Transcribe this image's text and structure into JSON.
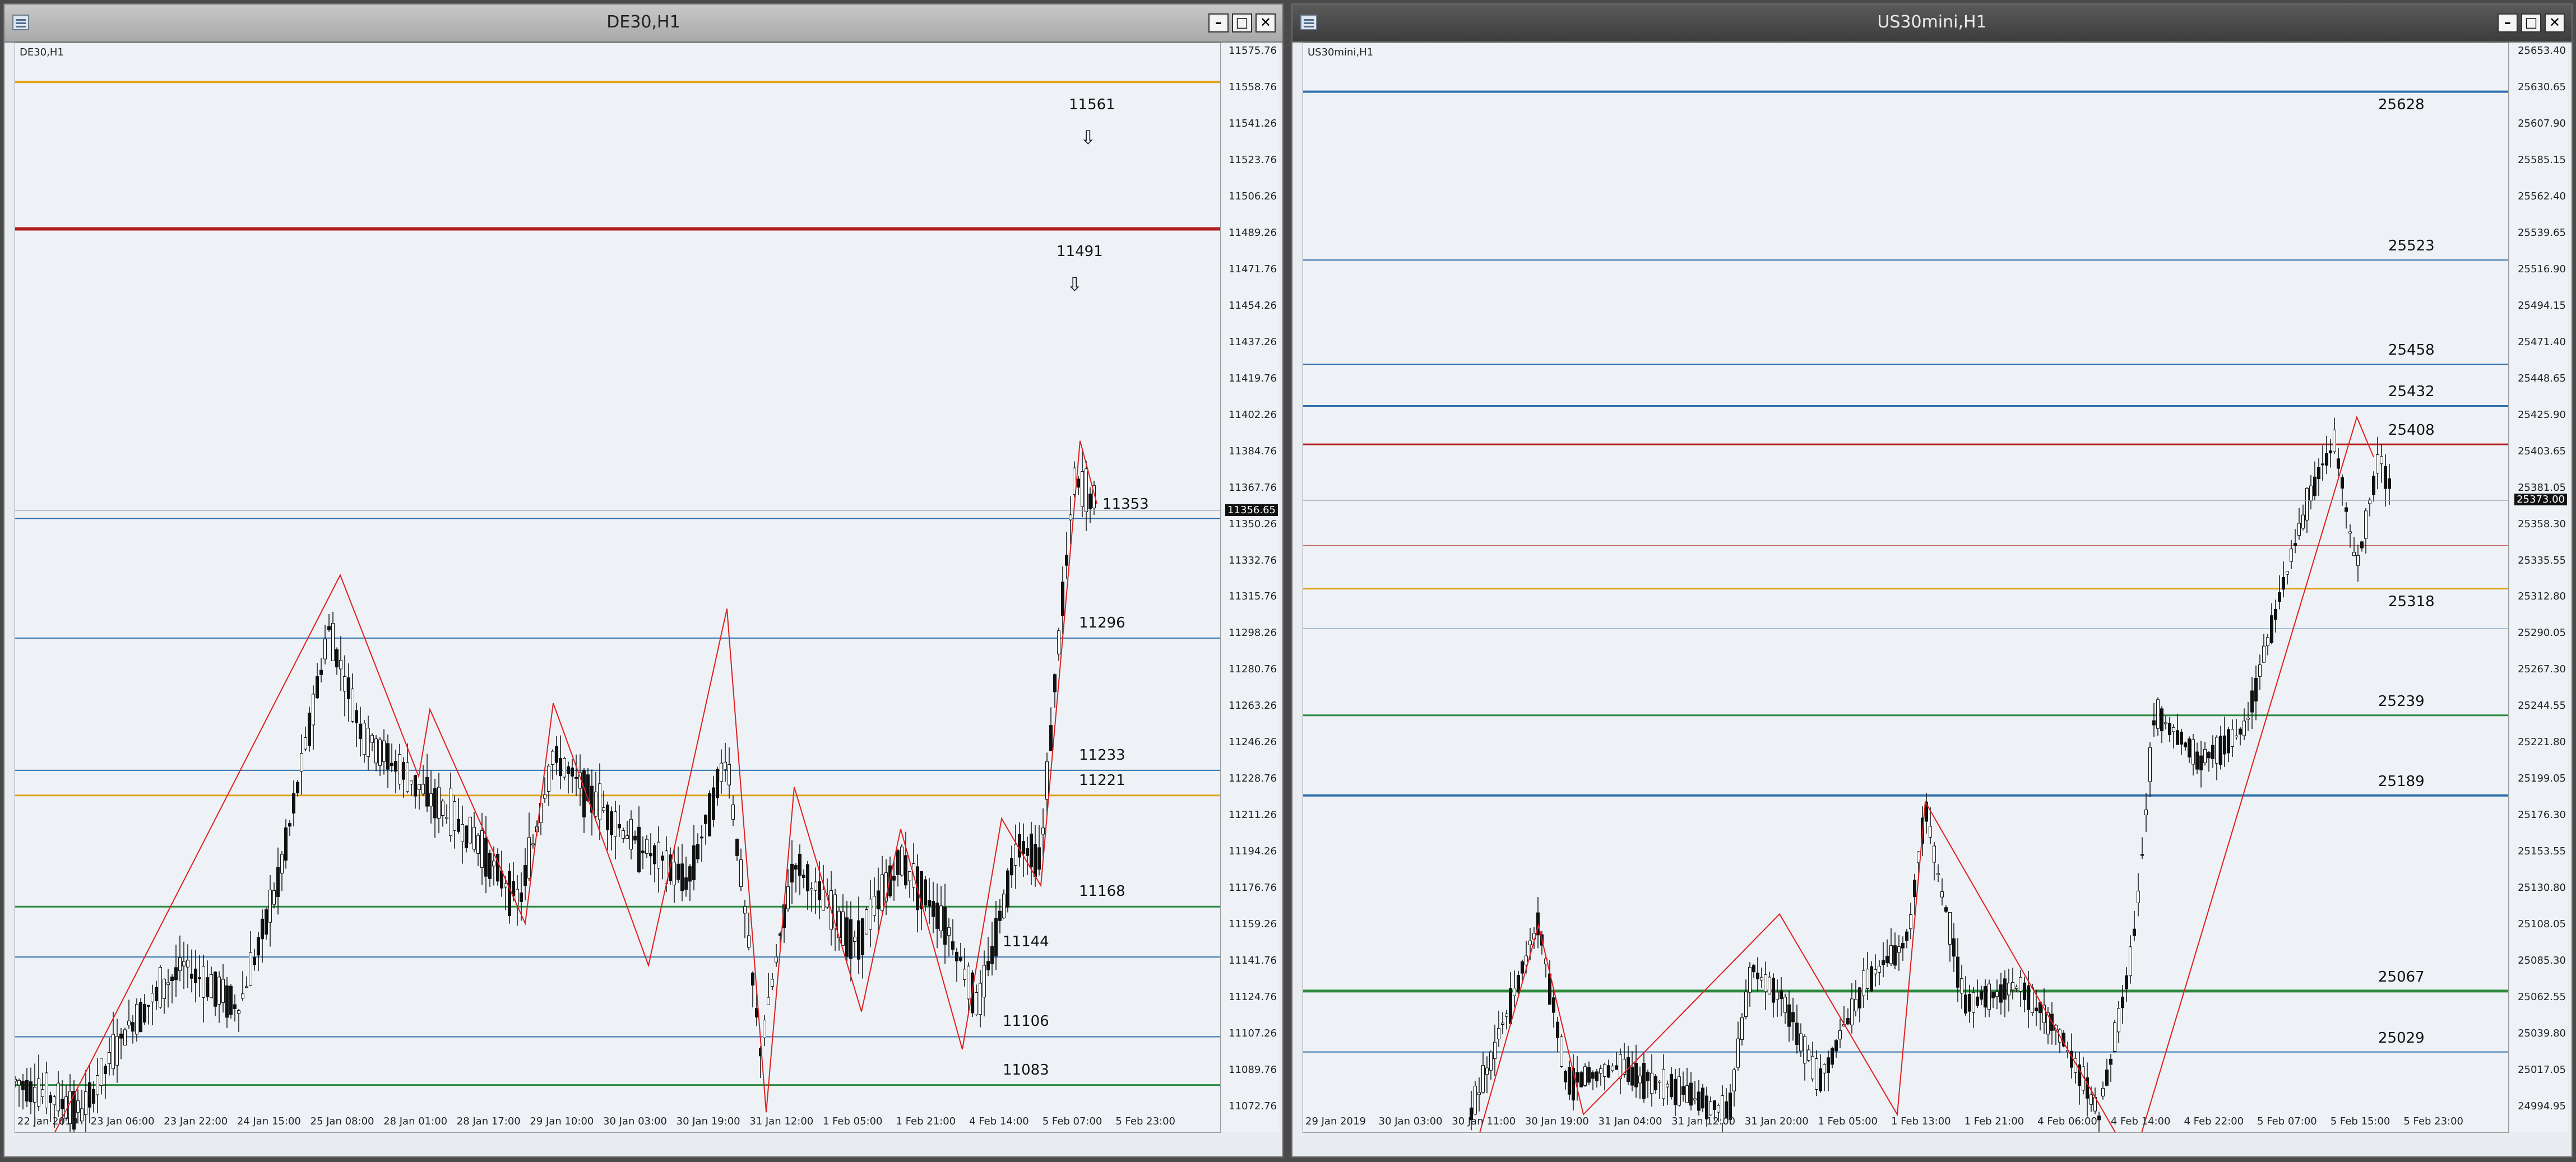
{
  "left": {
    "title": "DE30,H1",
    "symbol": "DE30,H1",
    "current_price": "11356.65",
    "price_ticks": [
      "11575.76",
      "11558.76",
      "11541.26",
      "11523.76",
      "11506.26",
      "11489.26",
      "11471.76",
      "11454.26",
      "11437.26",
      "11419.76",
      "11402.26",
      "11384.76",
      "11367.76",
      "11350.26",
      "11332.76",
      "11315.76",
      "11298.26",
      "11280.76",
      "11263.26",
      "11246.26",
      "11228.76",
      "11211.26",
      "11194.26",
      "11176.76",
      "11159.26",
      "11141.76",
      "11124.76",
      "11107.26",
      "11089.76",
      "11072.76"
    ],
    "time_ticks": [
      "22 Jan 2019",
      "23 Jan 06:00",
      "23 Jan 22:00",
      "24 Jan 15:00",
      "25 Jan 08:00",
      "28 Jan 01:00",
      "28 Jan 17:00",
      "29 Jan 10:00",
      "30 Jan 03:00",
      "30 Jan 19:00",
      "31 Jan 12:00",
      "1 Feb 05:00",
      "1 Feb 21:00",
      "4 Feb 14:00",
      "5 Feb 07:00",
      "5 Feb 23:00"
    ],
    "levels": [
      {
        "label": "11561",
        "price": 11561,
        "color": "#e0a21a",
        "width": 4
      },
      {
        "label": "11491",
        "price": 11491,
        "color": "#b01e1e",
        "width": 6
      },
      {
        "label": "11353",
        "price": 11353,
        "color": "#2f6fad",
        "width": 2
      },
      {
        "label": "11296",
        "price": 11296,
        "color": "#2f6fad",
        "width": 2
      },
      {
        "label": "11233",
        "price": 11233,
        "color": "#2f6fad",
        "width": 2
      },
      {
        "label": "11221",
        "price": 11221,
        "color": "#e0a21a",
        "width": 3
      },
      {
        "label": "11168",
        "price": 11168,
        "color": "#2b8a3e",
        "width": 3
      },
      {
        "label": "11144",
        "price": 11144,
        "color": "#2f6fad",
        "width": 2
      },
      {
        "label": "11106",
        "price": 11106,
        "color": "#2f6fad",
        "width": 2
      },
      {
        "label": "11083",
        "price": 11083,
        "color": "#2b8a3e",
        "width": 3
      }
    ],
    "arrows": [
      "⇩",
      "⇩"
    ]
  },
  "right": {
    "title": "US30mini,H1",
    "symbol": "US30mini,H1",
    "current_price": "25373.00",
    "price_ticks": [
      "25653.40",
      "25630.65",
      "25607.90",
      "25585.15",
      "25562.40",
      "25539.65",
      "25516.90",
      "25494.15",
      "25471.40",
      "25448.65",
      "25425.90",
      "25403.65",
      "25381.05",
      "25358.30",
      "25335.55",
      "25312.80",
      "25290.05",
      "25267.30",
      "25244.55",
      "25221.80",
      "25199.05",
      "25176.30",
      "25153.55",
      "25130.80",
      "25108.05",
      "25085.30",
      "25062.55",
      "25039.80",
      "25017.05",
      "24994.95"
    ],
    "time_ticks": [
      "29 Jan 2019",
      "30 Jan 03:00",
      "30 Jan 11:00",
      "30 Jan 19:00",
      "31 Jan 04:00",
      "31 Jan 12:00",
      "31 Jan 20:00",
      "1 Feb 05:00",
      "1 Feb 13:00",
      "1 Feb 21:00",
      "4 Feb 06:00",
      "4 Feb 14:00",
      "4 Feb 22:00",
      "5 Feb 07:00",
      "5 Feb 15:00",
      "5 Feb 23:00"
    ],
    "levels": [
      {
        "label": "25628",
        "price": 25628,
        "color": "#2f6fad",
        "width": 4
      },
      {
        "label": "25523",
        "price": 25523,
        "color": "#2f6fad",
        "width": 2
      },
      {
        "label": "25458",
        "price": 25458,
        "color": "#2f6fad",
        "width": 2
      },
      {
        "label": "25432",
        "price": 25432,
        "color": "#2f6fad",
        "width": 3
      },
      {
        "label": "25408",
        "price": 25408,
        "color": "#b01e1e",
        "width": 3
      },
      {
        "label": "25318",
        "price": 25318,
        "color": "#e0a21a",
        "width": 3
      },
      {
        "label": "25239",
        "price": 25239,
        "color": "#2b8a3e",
        "width": 3
      },
      {
        "label": "25189",
        "price": 25189,
        "color": "#2f6fad",
        "width": 4
      },
      {
        "label": "25067",
        "price": 25067,
        "color": "#2b8a3e",
        "width": 5
      },
      {
        "label": "25029",
        "price": 25029,
        "color": "#2f6fad",
        "width": 2
      }
    ]
  },
  "colors": {
    "background": "#eef2f6",
    "zigzag": "#e02020",
    "candle": "#111111"
  }
}
